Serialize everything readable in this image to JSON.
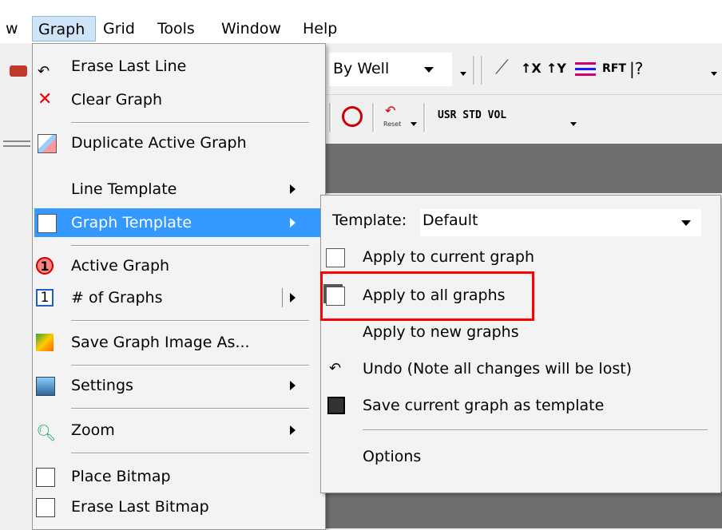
{
  "menubar": {
    "items": [
      {
        "label": "w",
        "accent": ""
      },
      {
        "label": "Graph",
        "accent": "G"
      },
      {
        "label": "Grid",
        "accent": "r"
      },
      {
        "label": "Tools",
        "accent": "T"
      },
      {
        "label": "Window",
        "accent": "W"
      },
      {
        "label": "Help",
        "accent": "H"
      }
    ]
  },
  "toolbar": {
    "by_well": "By Well",
    "reset": "Reset",
    "usr_std_vol": "USR STD VOL",
    "rft": "RFT",
    "dx": "↑X",
    "dy": "↑Y"
  },
  "graph_menu": {
    "erase_last_line": "Erase Last Line",
    "clear_graph": "Clear Graph",
    "duplicate_active_graph": "Duplicate Active Graph",
    "line_template": "Line Template",
    "graph_template": "Graph Template",
    "active_graph": "Active Graph",
    "num_graphs": "# of Graphs",
    "save_graph_image": "Save Graph Image As...",
    "settings": "Settings",
    "zoom": "Zoom",
    "place_bitmap": "Place Bitmap",
    "erase_last_bitmap": "Erase Last Bitmap"
  },
  "template_submenu": {
    "template_label": "Template:",
    "template_value": "Default",
    "apply_current": "Apply to current graph",
    "apply_all": "Apply to all graphs",
    "apply_new": "Apply to new graphs",
    "undo": "Undo (Note all changes will be lost)",
    "save_template": "Save current graph as template",
    "options": "Options"
  },
  "colors": {
    "highlight": "#3399ff",
    "callout": "#ff0000",
    "dark_panel": "#6f6f6f"
  }
}
